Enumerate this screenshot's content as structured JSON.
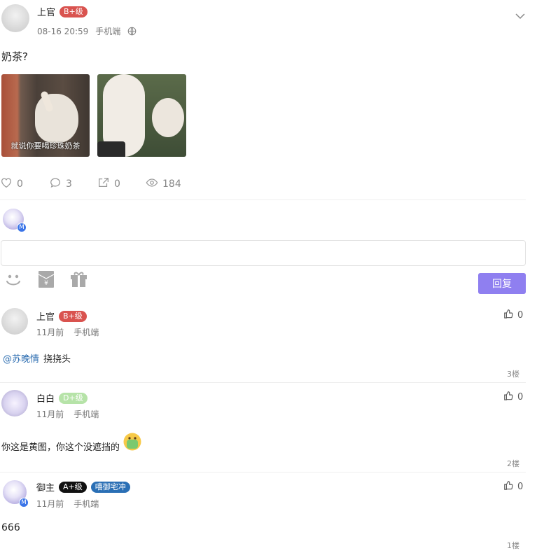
{
  "post": {
    "author": "上官",
    "level_badge": "B+级",
    "time": "08-16 20:59",
    "device": "手机端",
    "content": "奶茶?",
    "image1_caption": "就说你要喝珍珠奶茶",
    "stats": {
      "likes": "0",
      "comments": "3",
      "shares": "0",
      "views": "184"
    }
  },
  "reply_button": "回复",
  "comments": [
    {
      "author": "上官",
      "level_badge": "B+级",
      "badge_color": "#d9534f",
      "time": "11月前",
      "device": "手机端",
      "mention": "@苏晚情",
      "text": "挠挠头",
      "likes": "0",
      "floor": "3楼"
    },
    {
      "author": "白白",
      "level_badge": "D+级",
      "badge_color": "#b6e3a8",
      "time": "11月前",
      "device": "手机端",
      "text": "你这是黄图，你这个没遮挡的",
      "likes": "0",
      "floor": "2楼"
    },
    {
      "author": "御主",
      "level_badge": "A+级",
      "badge_color": "#111111",
      "title_badge": "嘻御宅冲",
      "title_badge_color": "#2a6fb5",
      "time": "11月前",
      "device": "手机端",
      "text": "666",
      "likes": "0",
      "floor": "1楼"
    }
  ]
}
